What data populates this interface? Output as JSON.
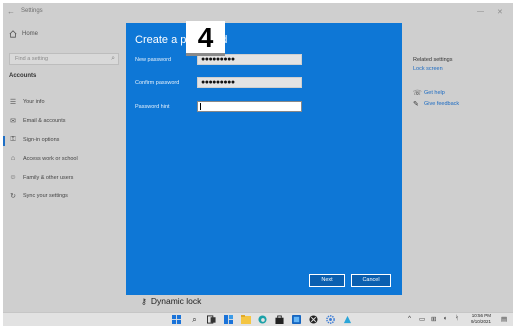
{
  "window": {
    "title": "Settings",
    "back_glyph": "←",
    "minimize_glyph": "—",
    "close_glyph": "✕"
  },
  "sidebar": {
    "home": "Home",
    "search_placeholder": "Find a setting",
    "section": "Accounts",
    "items": [
      {
        "label": "Your info",
        "icon": "person-card-icon"
      },
      {
        "label": "Email & accounts",
        "icon": "mail-icon"
      },
      {
        "label": "Sign-in options",
        "icon": "key-icon"
      },
      {
        "label": "Access work or school",
        "icon": "briefcase-icon"
      },
      {
        "label": "Family & other users",
        "icon": "people-icon"
      },
      {
        "label": "Sync your settings",
        "icon": "sync-icon"
      }
    ]
  },
  "related": {
    "title": "Related settings",
    "lock_screen": "Lock screen",
    "get_help": "Get help",
    "give_feedback": "Give feedback"
  },
  "content": {
    "dynamic_lock": "Dynamic lock"
  },
  "dialog": {
    "title": "Create a password",
    "new_password_label": "New password",
    "new_password_value": "●●●●●●●●●",
    "confirm_password_label": "Confirm password",
    "confirm_password_value": "●●●●●●●●●",
    "hint_label": "Password hint",
    "hint_value": "",
    "next": "Next",
    "cancel": "Cancel"
  },
  "step_badge": "4",
  "taskbar": {
    "time": "10:56 PM",
    "date": "9/10/2021",
    "tray_chevron": "^"
  },
  "colors": {
    "dialog_blue": "#0e77d6",
    "accent": "#1f6fc5"
  }
}
